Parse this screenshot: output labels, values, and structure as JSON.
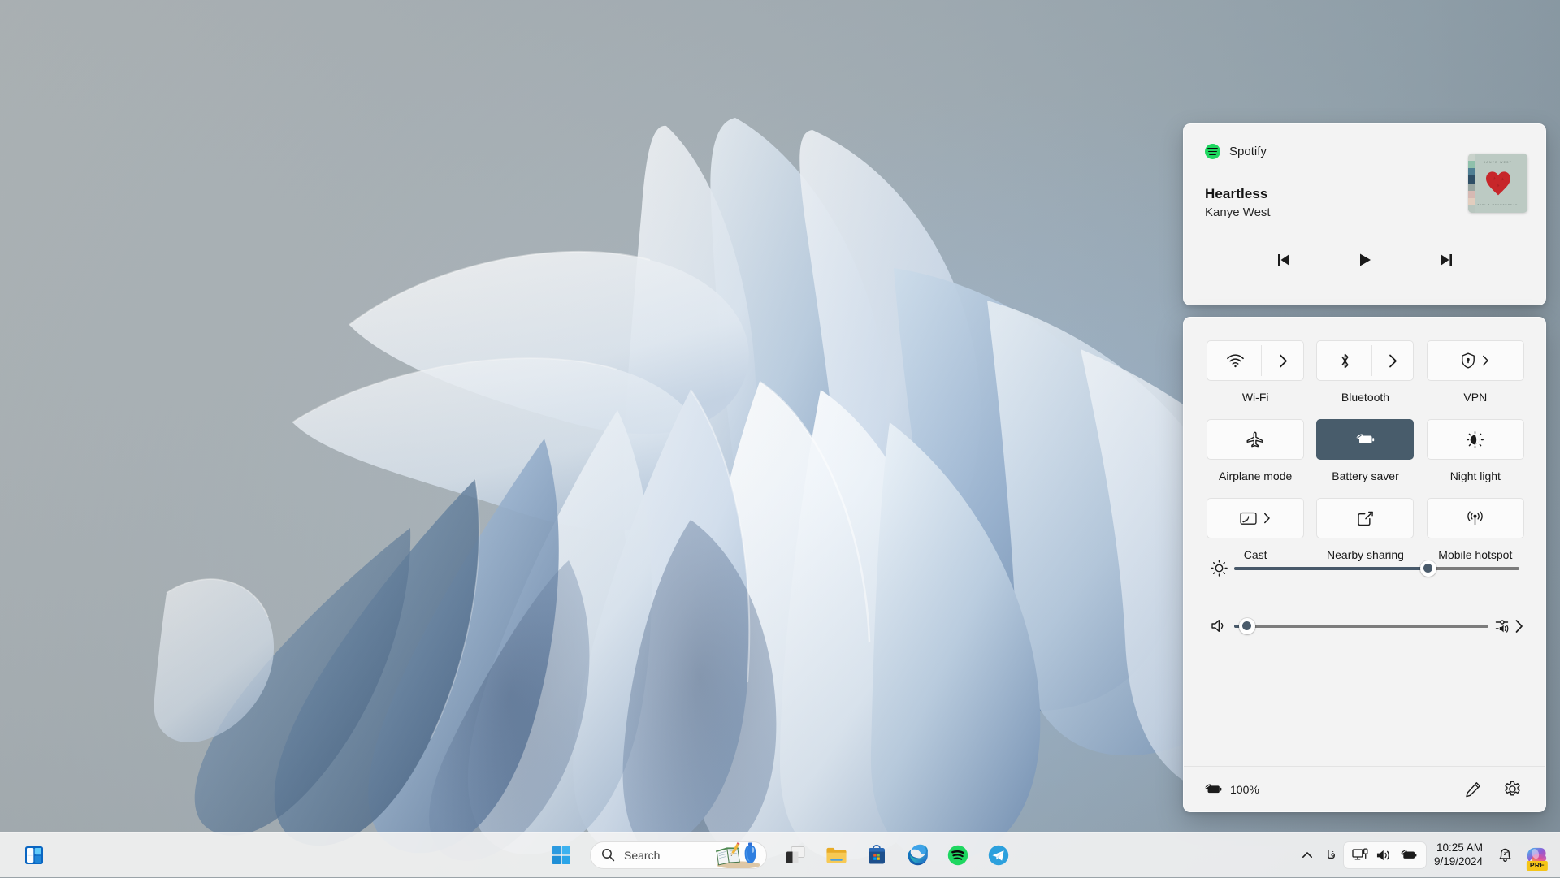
{
  "desktop": {
    "wallpaper_name": "windows-11-bloom",
    "colors": {
      "bg_light": "#b9c0c3",
      "bg_dark": "#8798a5",
      "petal_light": "#eef3f8",
      "petal_mid": "#b6c8dd",
      "petal_dark": "#4f6c91"
    }
  },
  "media_flyout": {
    "app_name": "Spotify",
    "track_title": "Heartless",
    "artist": "Kanye West",
    "album_art": {
      "top_text": "KANYE WEST",
      "bottom_text": "808s & HEARTBREAK",
      "bg_color": "#bccac3",
      "heart_color": "#c7262a"
    },
    "controls": [
      {
        "name": "previous-track-button",
        "icon": "skip-previous-icon"
      },
      {
        "name": "play-button",
        "icon": "play-icon"
      },
      {
        "name": "next-track-button",
        "icon": "skip-next-icon"
      }
    ]
  },
  "quick_settings": {
    "accent_color": "#485c6b",
    "tiles": [
      {
        "label": "Wi-Fi",
        "icon": "wifi-icon",
        "state": "off",
        "has_chevron": true,
        "split": true
      },
      {
        "label": "Bluetooth",
        "icon": "bluetooth-icon",
        "state": "off",
        "has_chevron": true,
        "split": true
      },
      {
        "label": "VPN",
        "icon": "vpn-shield-icon",
        "state": "off",
        "has_chevron": true,
        "split": false
      },
      {
        "label": "Airplane mode",
        "icon": "airplane-icon",
        "state": "off",
        "has_chevron": false,
        "split": false
      },
      {
        "label": "Battery saver",
        "icon": "battery-saver-icon",
        "state": "on",
        "has_chevron": false,
        "split": false
      },
      {
        "label": "Night light",
        "icon": "night-light-icon",
        "state": "off",
        "has_chevron": false,
        "split": false
      },
      {
        "label": "Cast",
        "icon": "cast-icon",
        "state": "off",
        "has_chevron": true,
        "split": false
      },
      {
        "label": "Nearby sharing",
        "icon": "nearby-sharing-icon",
        "state": "off",
        "has_chevron": false,
        "split": false
      },
      {
        "label": "Mobile hotspot",
        "icon": "mobile-hotspot-icon",
        "state": "off",
        "has_chevron": false,
        "split": false
      }
    ],
    "brightness": {
      "icon": "brightness-icon",
      "value": 68
    },
    "volume": {
      "icon": "speaker-icon",
      "value": 5,
      "mixer_icon": "volume-mixer-icon",
      "mixer_chevron": "chevron-right-icon"
    },
    "footer": {
      "battery_icon": "battery-saver-icon",
      "battery_percent": "100%",
      "edit_icon": "pencil-icon",
      "settings_icon": "gear-icon"
    }
  },
  "taskbar": {
    "widgets_icon": "widgets-icon",
    "start_icon": "windows-start-icon",
    "search": {
      "placeholder": "Search",
      "icon": "search-icon",
      "art": "notebook-pencil-and-bottle"
    },
    "apps": [
      {
        "name": "task-view",
        "icon": "task-view-icon"
      },
      {
        "name": "file-explorer",
        "icon": "folder-icon"
      },
      {
        "name": "microsoft-store",
        "icon": "store-icon"
      },
      {
        "name": "microsoft-edge",
        "icon": "edge-icon"
      },
      {
        "name": "spotify",
        "icon": "spotify-icon"
      },
      {
        "name": "telegram",
        "icon": "telegram-icon"
      }
    ],
    "tray": {
      "overflow_icon": "chevron-up-icon",
      "language": "فا",
      "group_icons": [
        "network-icon",
        "volume-icon",
        "battery-saver-icon"
      ],
      "time": "10:25 AM",
      "date": "9/19/2024",
      "notification_icon": "bell-dnd-icon",
      "copilot_icon": "copilot-icon",
      "copilot_badge": "PRE"
    }
  }
}
